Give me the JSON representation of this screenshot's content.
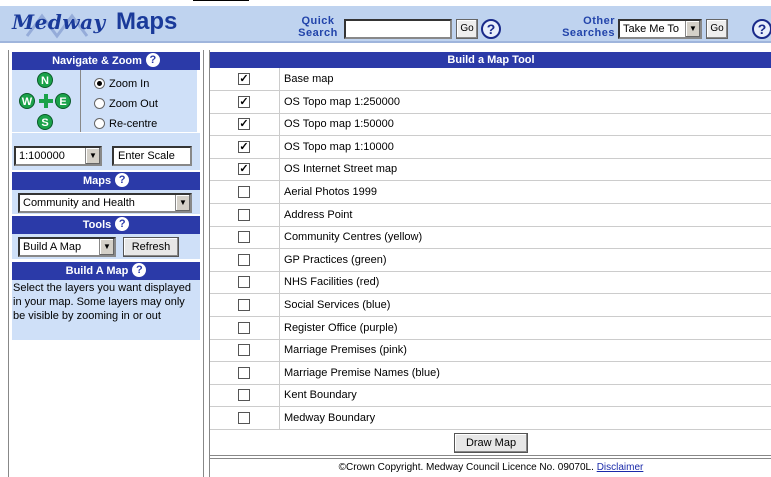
{
  "header": {
    "logo_medway": "Medway",
    "logo_maps": "Maps",
    "quick_search_label_1": "Quick",
    "quick_search_label_2": "Search",
    "quick_search_value": "",
    "go_label": "Go",
    "other_searches_label_1": "Other",
    "other_searches_label_2": "Searches",
    "other_searches_selected": "Take Me To"
  },
  "navigate": {
    "title": "Navigate & Zoom",
    "compass": {
      "n": "N",
      "s": "S",
      "e": "E",
      "w": "W"
    },
    "options": [
      "Zoom In",
      "Zoom Out",
      "Re-centre"
    ],
    "selected_option": "Zoom In",
    "scale_selected": "1:100000",
    "scale_input_value": "Enter Scale"
  },
  "maps": {
    "title": "Maps",
    "selected": "Community and Health"
  },
  "tools": {
    "title": "Tools",
    "selected": "Build A Map",
    "refresh_label": "Refresh"
  },
  "build_a_map": {
    "title": "Build A Map",
    "help_text": "Select the layers you want displayed in your map. Some layers may only be visible by zooming in or out"
  },
  "main": {
    "title": "Build a Map Tool",
    "layers": [
      {
        "label": "Base map",
        "checked": true
      },
      {
        "label": "OS Topo map 1:250000",
        "checked": true
      },
      {
        "label": "OS Topo map 1:50000",
        "checked": true
      },
      {
        "label": "OS Topo map 1:10000",
        "checked": true
      },
      {
        "label": "OS Internet Street map",
        "checked": true
      },
      {
        "label": "Aerial Photos 1999",
        "checked": false
      },
      {
        "label": "Address Point",
        "checked": false
      },
      {
        "label": "Community Centres (yellow)",
        "checked": false
      },
      {
        "label": "GP Practices (green)",
        "checked": false
      },
      {
        "label": "NHS Facilities (red)",
        "checked": false
      },
      {
        "label": "Social Services (blue)",
        "checked": false
      },
      {
        "label": "Register Office (purple)",
        "checked": false
      },
      {
        "label": "Marriage Premises (pink)",
        "checked": false
      },
      {
        "label": "Marriage Premise Names (blue)",
        "checked": false
      },
      {
        "label": "Kent Boundary",
        "checked": false
      },
      {
        "label": "Medway Boundary",
        "checked": false
      }
    ],
    "draw_map_label": "Draw Map",
    "footer_text": "©Crown Copyright. Medway Council Licence No. 09070L.",
    "footer_link": "Disclaimer"
  },
  "colors": {
    "header_bg": "#bfd3ef",
    "panel_title_bg": "#2b3aa8",
    "panel_bg": "#cfe0f8",
    "compass_green": "#1aa24a"
  }
}
